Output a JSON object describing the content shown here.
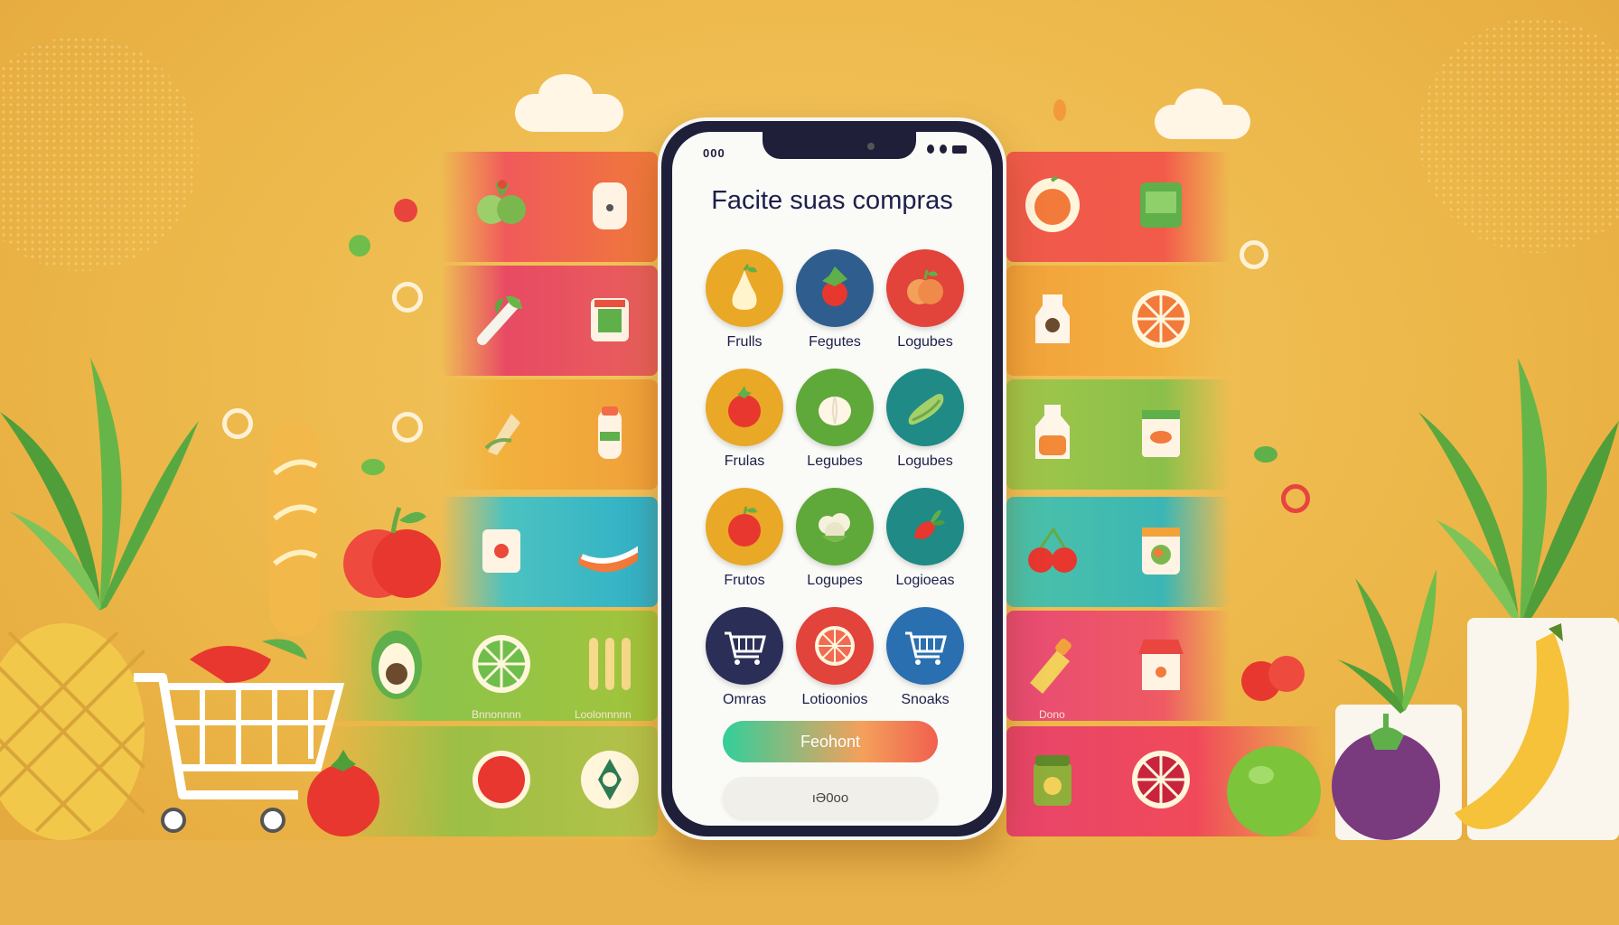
{
  "status": {
    "left": "000"
  },
  "app": {
    "title": "Facite suas compras"
  },
  "categories": [
    {
      "label": "Frulls",
      "color": "#e9a825",
      "icon": "pear-icon"
    },
    {
      "label": "Fegutes",
      "color": "#2f5d8e",
      "icon": "strawberry-icon"
    },
    {
      "label": "Logubes",
      "color": "#e2433b",
      "icon": "peach-icon"
    },
    {
      "label": "Frulas",
      "color": "#e9a825",
      "icon": "tomato-icon"
    },
    {
      "label": "Legubes",
      "color": "#5fa83a",
      "icon": "garlic-icon"
    },
    {
      "label": "Logubes",
      "color": "#1f8a86",
      "icon": "cucumber-icon"
    },
    {
      "label": "Frutos",
      "color": "#e9a825",
      "icon": "apple-icon"
    },
    {
      "label": "Logupes",
      "color": "#5fa83a",
      "icon": "cauliflower-icon"
    },
    {
      "label": "Logioeas",
      "color": "#1f8a86",
      "icon": "radish-icon"
    },
    {
      "label": "Omras",
      "color": "#2b2e57",
      "icon": "cart-icon"
    },
    {
      "label": "Lotioonios",
      "color": "#e2433b",
      "icon": "citrus-slice-icon"
    },
    {
      "label": "Snoaks",
      "color": "#2a6fb0",
      "icon": "basket-icon"
    }
  ],
  "buttons": {
    "primary": "Feohont",
    "secondary": "ıƏ0oo"
  },
  "side_labels": {
    "left_1": "Bnnonnnn",
    "left_2": "Loolonnnnn",
    "right_1": "Dono"
  }
}
